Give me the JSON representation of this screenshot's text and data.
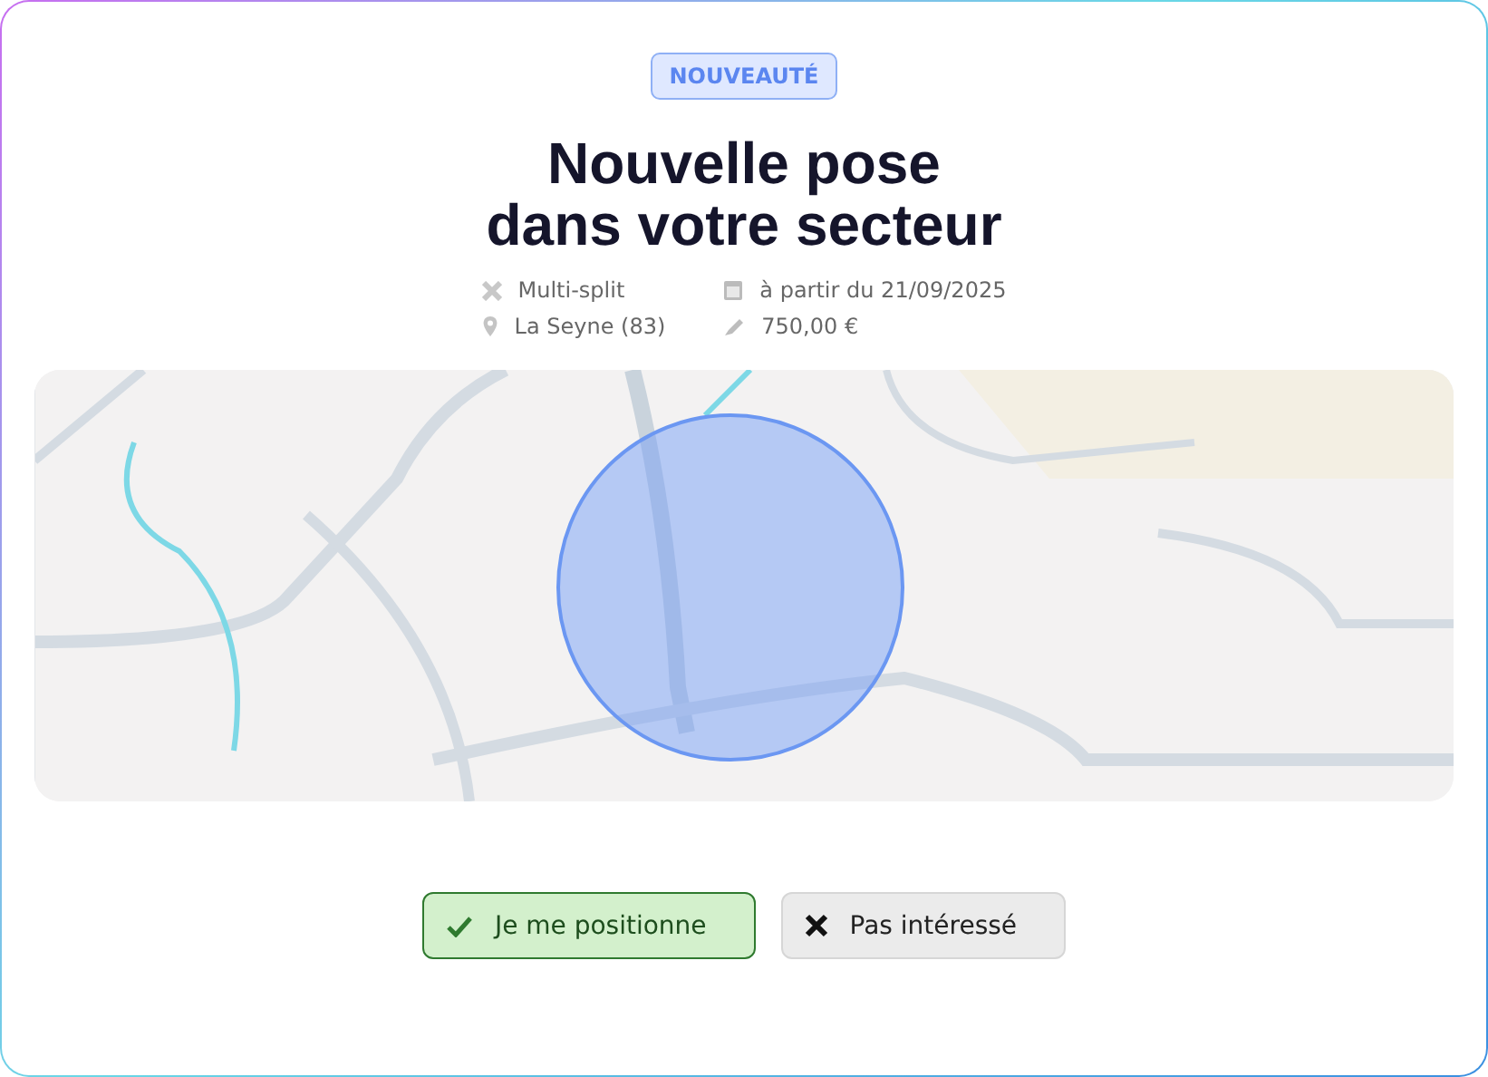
{
  "badge": "NOUVEAUTÉ",
  "title": [
    "Nouvelle pose",
    "dans votre secteur"
  ],
  "details": [
    {
      "kind": "split",
      "text": "Multi-split"
    },
    {
      "kind": "date",
      "text": "à partir du 21/09/2025"
    },
    {
      "kind": "location",
      "text": "La Seyne (83)"
    },
    {
      "kind": "price",
      "text": "750,00 €"
    }
  ],
  "buttons": [
    {
      "kind": "accept",
      "label": "Je me positionne"
    },
    {
      "kind": "decline",
      "label": "Pas intéressé"
    }
  ]
}
